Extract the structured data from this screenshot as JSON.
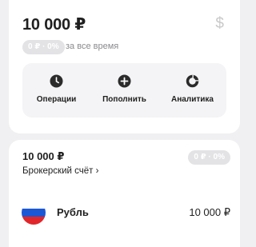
{
  "summary": {
    "balance": "10 000 ₽",
    "currency_icon": "dollar-sign-icon",
    "change_badge": "0 ₽ · 0%",
    "period_label": "за все время",
    "actions": [
      {
        "label": "Операции",
        "icon": "clock-icon"
      },
      {
        "label": "Пополнить",
        "icon": "plus-circle-icon"
      },
      {
        "label": "Аналитика",
        "icon": "pie-chart-icon"
      }
    ]
  },
  "account": {
    "balance": "10 000 ₽",
    "change_badge": "0 ₽ · 0%",
    "type_label": "Брокерский счёт ›",
    "holdings": [
      {
        "name": "Рубль",
        "amount": "10 000 ₽",
        "icon": "russia-flag-icon"
      }
    ]
  },
  "colors": {
    "background": "#f0f0f2",
    "card": "#ffffff",
    "badge": "#e3e3e6",
    "muted_text": "#8a8a8e",
    "flag_white": "#ffffff",
    "flag_blue": "#1c57d6",
    "flag_red": "#e0262b"
  }
}
